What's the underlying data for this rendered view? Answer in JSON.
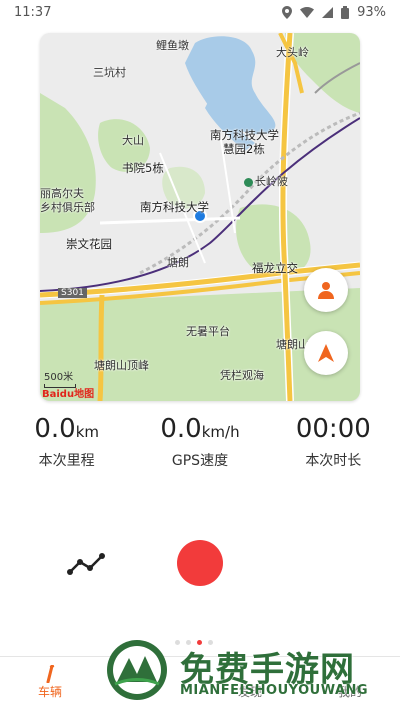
{
  "status_bar": {
    "time": "11:37",
    "battery": "93%"
  },
  "map": {
    "labels": {
      "liyudun": "鲤鱼墩",
      "sankengcun": "三坑村",
      "datouling": "大头岭",
      "dashan": "大山",
      "sustech": "南方科技大学",
      "huiyuan": "慧园2栋",
      "shuyuan": "书院5栋",
      "changlingpi": "长岭陂",
      "golf1": "丽高尔夫",
      "golf2": "乡村俱乐部",
      "sustech2": "南方科技大学",
      "chongwen": "崇文花园",
      "tanglang": "塘朗",
      "fulong": "福龙立交",
      "s301": "S301",
      "wushu": "无暑平台",
      "tanglanggong": "塘朗山公",
      "tanglangpeak": "塘朗山顶峰",
      "pinglan": "凭栏观海"
    },
    "scale": "500米",
    "logo": "Baidu地图"
  },
  "stats": [
    {
      "value": "0.0",
      "unit": "km",
      "label": "本次里程"
    },
    {
      "value": "0.0",
      "unit": "km/h",
      "label": "GPS速度"
    },
    {
      "value": "00:00",
      "unit": "",
      "label": "本次时长"
    }
  ],
  "tabs": [
    {
      "label": "车辆",
      "icon": "bike-icon"
    },
    {
      "label": "",
      "icon": ""
    },
    {
      "label": "发现",
      "icon": "discover-icon"
    },
    {
      "label": "我的",
      "icon": "profile-icon"
    }
  ],
  "watermark": {
    "title": "免费手游网",
    "subtitle": "MIANFEISHOUYOUWANG"
  },
  "colors": {
    "accent": "#f0661f",
    "record": "#f23b3b",
    "map_green": "#c9e3b4",
    "road_yellow": "#f5c542"
  }
}
